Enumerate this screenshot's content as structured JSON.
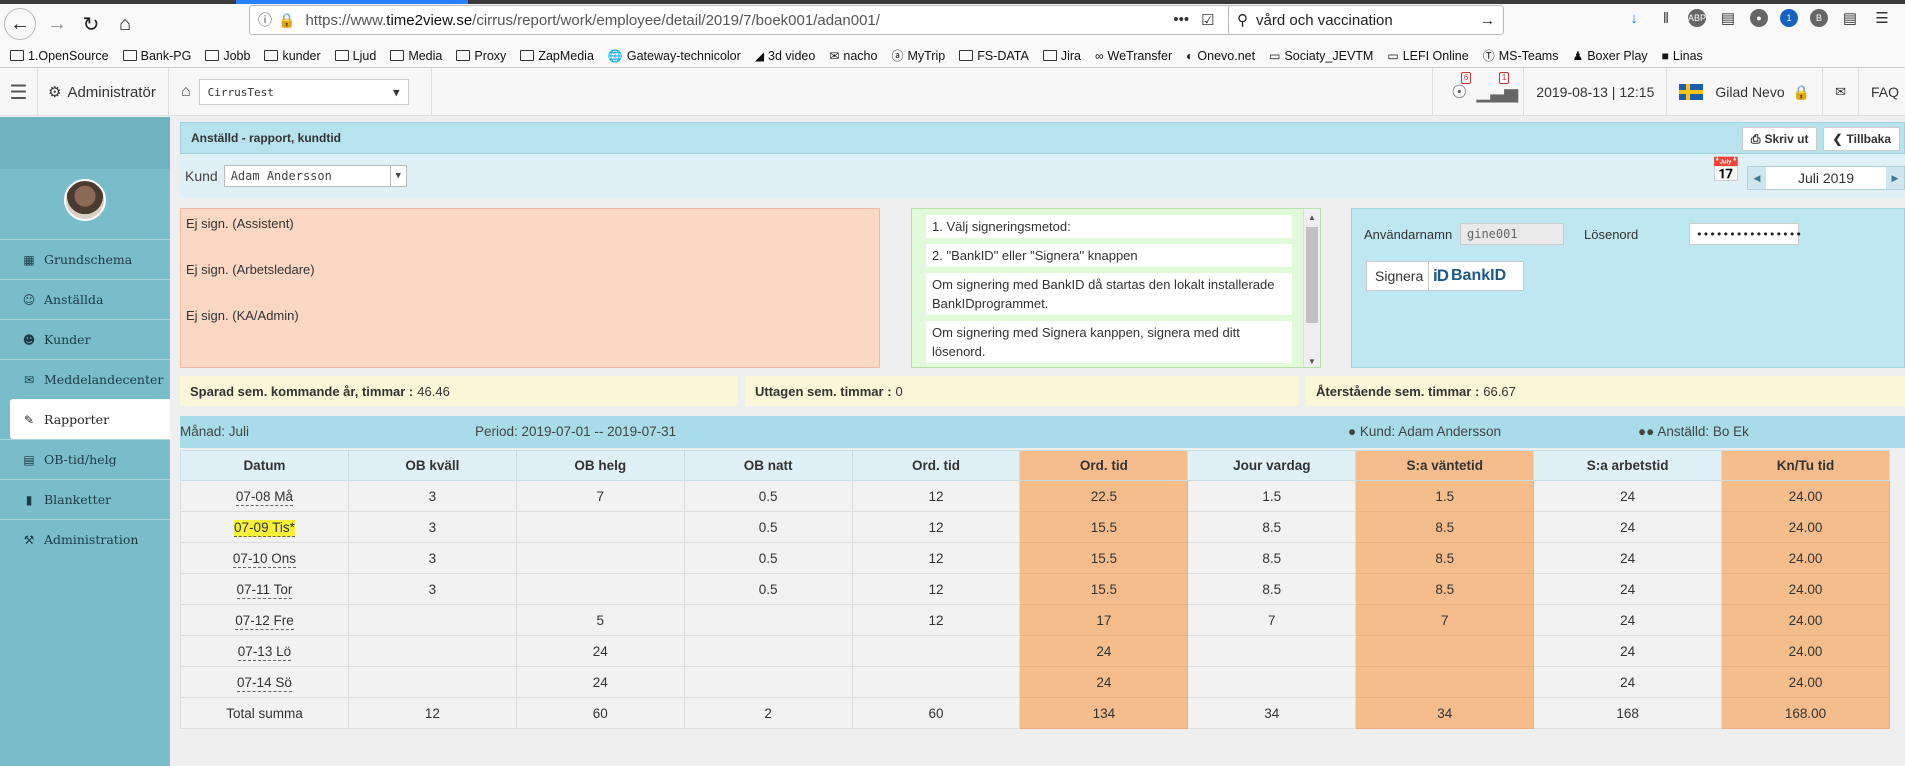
{
  "browser": {
    "url_prefix": "https://www.",
    "url_host": "time2view.se",
    "url_path": "/cirrus/report/work/employee/detail/2019/7/boek001/adan001/",
    "more": "•••",
    "search_query": "vård och vaccination",
    "bookmarks": [
      {
        "label": "1.OpenSource",
        "icon": "folder-icon"
      },
      {
        "label": "Bank-PG",
        "icon": "folder-icon"
      },
      {
        "label": "Jobb",
        "icon": "folder-icon"
      },
      {
        "label": "kunder",
        "icon": "folder-icon"
      },
      {
        "label": "Ljud",
        "icon": "folder-icon"
      },
      {
        "label": "Media",
        "icon": "folder-icon"
      },
      {
        "label": "Proxy",
        "icon": "folder-icon"
      },
      {
        "label": "ZapMedia",
        "icon": "folder-icon"
      },
      {
        "label": "Gateway-technicolor",
        "icon": "globe-icon"
      },
      {
        "label": "3d video",
        "icon": "rss-icon"
      },
      {
        "label": "nacho",
        "icon": "mail-icon"
      },
      {
        "label": "MyTrip",
        "icon": "mytrip-icon"
      },
      {
        "label": "FS-DATA",
        "icon": "folder-icon"
      },
      {
        "label": "Jira",
        "icon": "folder-icon"
      },
      {
        "label": "WeTransfer",
        "icon": "wetransfer-icon"
      },
      {
        "label": "Onevo.net",
        "icon": "onevo-icon"
      },
      {
        "label": "Sociaty_JEVTM",
        "icon": "page-icon"
      },
      {
        "label": "LEFI Online",
        "icon": "page-icon"
      },
      {
        "label": "MS-Teams",
        "icon": "teams-icon"
      },
      {
        "label": "Boxer Play",
        "icon": "boxer-icon"
      },
      {
        "label": "Linas",
        "icon": "bag-icon"
      }
    ]
  },
  "header": {
    "role": "Administratör",
    "company": "CirrusTest",
    "badge_1": "6",
    "badge_2": "1",
    "datetime": "2019-08-13 | 12:15",
    "user": "Gilad Nevo",
    "faq": "FAQ"
  },
  "sidebar": {
    "items": [
      {
        "label": "Grundschema",
        "icon": "calendar-icon"
      },
      {
        "label": "Anställda",
        "icon": "users-icon"
      },
      {
        "label": "Kunder",
        "icon": "user-icon"
      },
      {
        "label": "Meddelandecenter",
        "icon": "envelope-icon"
      },
      {
        "label": "Rapporter",
        "icon": "pencil-icon"
      },
      {
        "label": "OB-tid/helg",
        "icon": "chart-icon"
      },
      {
        "label": "Blanketter",
        "icon": "document-icon"
      },
      {
        "label": "Administration",
        "icon": "wrench-icon"
      }
    ],
    "active_index": 4
  },
  "page": {
    "title": "Anställd - rapport, kundtid",
    "print_button": "Skriv ut",
    "back_button": "Tillbaka",
    "kund_label": "Kund",
    "kund_value": "Adam Andersson",
    "month": "Juli 2019"
  },
  "sign": {
    "assistant": "Ej sign. (Assistent)",
    "supervisor": "Ej sign. (Arbetsledare)",
    "admin": "Ej sign. (KA/Admin)"
  },
  "info_steps": [
    "1. Välj signeringsmetod:",
    "2. \"BankID\" eller \"Signera\" knappen",
    "Om signering med BankID då startas den lokalt installerade BankIDprogrammet.",
    "Om signering med Signera kanppen, signera med ditt lösenord."
  ],
  "login": {
    "username_label": "Användarnamn",
    "username_value": "gine001",
    "password_label": "Lösenord",
    "password_value": "••••••••••••••••",
    "signera_button": "Signera",
    "bankid_logo": "iD",
    "bankid_text": "BankID"
  },
  "summary": {
    "saved_label": "Sparad sem. kommande år, timmar :",
    "saved_value": "46.46",
    "taken_label": "Uttagen sem. timmar :",
    "taken_value": "0",
    "remaining_label": "Återstående sem. timmar :",
    "remaining_value": "66.67"
  },
  "period": {
    "month": "Månad: Juli",
    "range": "Period: 2019-07-01 -- 2019-07-31",
    "customer": "Kund: Adam Andersson",
    "employee": "Anställd: Bo Ek"
  },
  "table": {
    "columns": [
      "Datum",
      "OB kväll",
      "OB helg",
      "OB natt",
      "Ord. tid",
      "Ord. tid",
      "Jour vardag",
      "S:a väntetid",
      "S:a arbetstid",
      "Kn/Tu tid"
    ],
    "highlight_cols": [
      5,
      7,
      9
    ],
    "rows": [
      [
        "07-08 Må",
        "3",
        "7",
        "0.5",
        "12",
        "22.5",
        "1.5",
        "1.5",
        "24",
        "24.00"
      ],
      [
        "07-09 Tis*",
        "3",
        "",
        "0.5",
        "12",
        "15.5",
        "8.5",
        "8.5",
        "24",
        "24.00"
      ],
      [
        "07-10 Ons",
        "3",
        "",
        "0.5",
        "12",
        "15.5",
        "8.5",
        "8.5",
        "24",
        "24.00"
      ],
      [
        "07-11 Tor",
        "3",
        "",
        "0.5",
        "12",
        "15.5",
        "8.5",
        "8.5",
        "24",
        "24.00"
      ],
      [
        "07-12 Fre",
        "",
        "5",
        "",
        "12",
        "17",
        "7",
        "7",
        "24",
        "24.00"
      ],
      [
        "07-13 Lö",
        "",
        "24",
        "",
        "",
        "24",
        "",
        "",
        "24",
        "24.00"
      ],
      [
        "07-14 Sö",
        "",
        "24",
        "",
        "",
        "24",
        "",
        "",
        "24",
        "24.00"
      ]
    ],
    "marked_row": 1,
    "total": [
      "Total summa",
      "12",
      "60",
      "2",
      "60",
      "134",
      "34",
      "34",
      "168",
      "168.00"
    ]
  },
  "colors": {
    "sidebar": "#78bdc9",
    "highlight_col": "#f5bd8c",
    "sign_box": "#fcd7c4",
    "info_box": "#e1fad9",
    "login_box": "#bfe7f1",
    "marker": "#f7f13a"
  }
}
